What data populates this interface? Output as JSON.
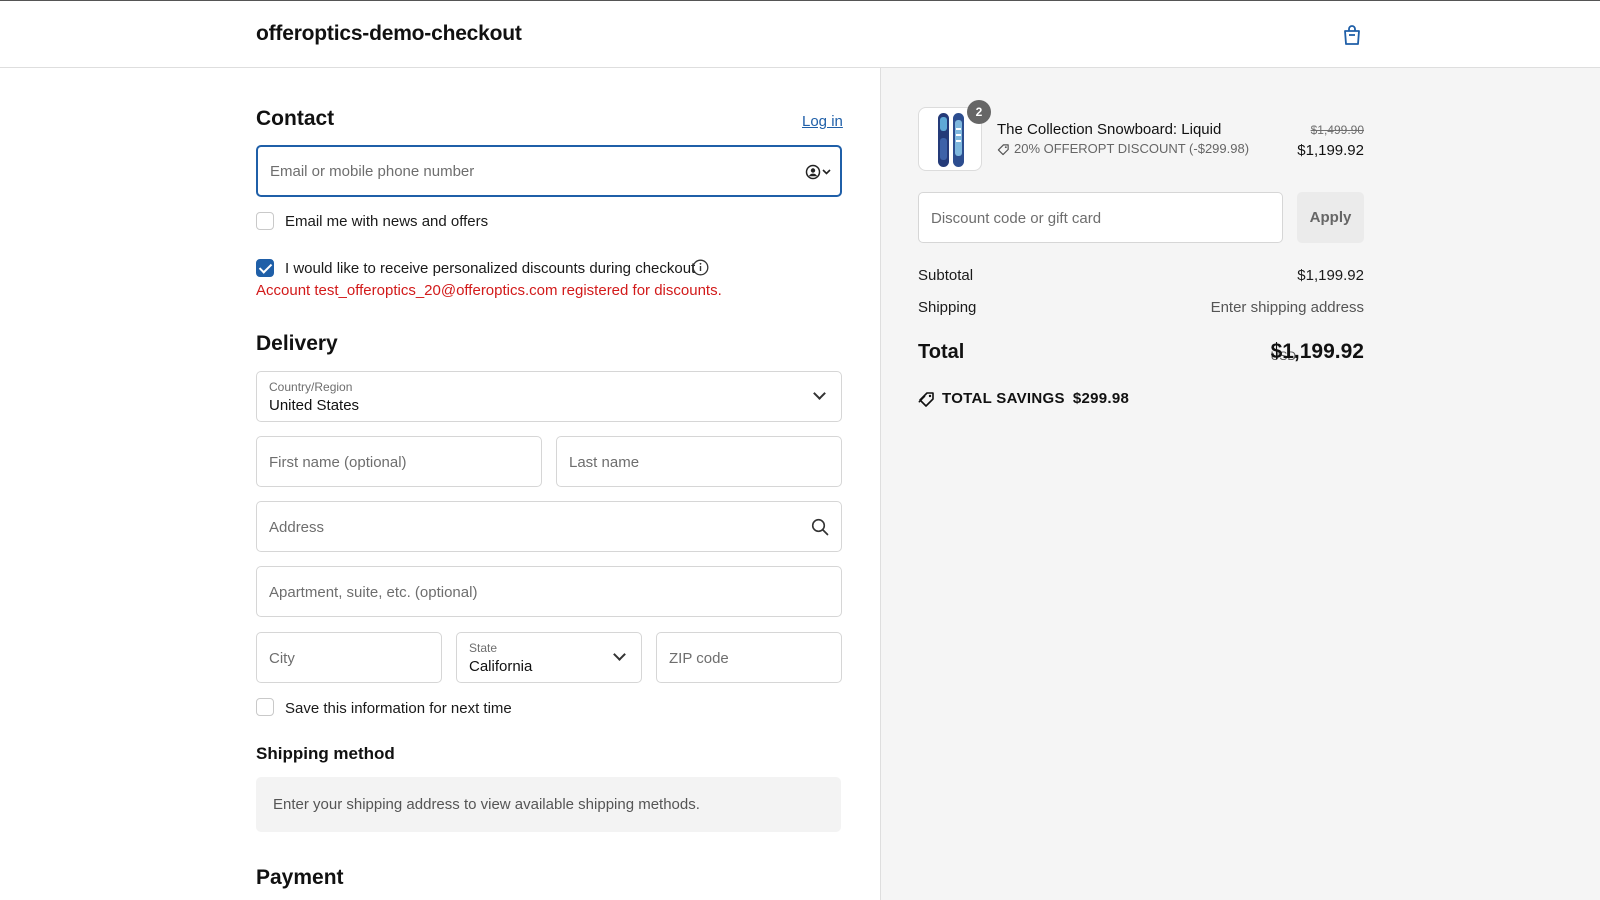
{
  "header": {
    "shop_name": "offeroptics-demo-checkout",
    "cart_icon": "shopping-bag-icon"
  },
  "contact": {
    "title": "Contact",
    "login_link": "Log in",
    "email_placeholder": "Email or mobile phone number",
    "email_value": "",
    "news_label": "Email me with news and offers",
    "news_checked": false,
    "personal_label": "I would like to receive personalized discounts during checkout",
    "personal_checked": true,
    "error_msg": "Account test_offeroptics_20@offeroptics.com registered for discounts."
  },
  "delivery": {
    "title": "Delivery",
    "country_label": "Country/Region",
    "country_value": "United States",
    "first_name_ph": "First name (optional)",
    "last_name_ph": "Last name",
    "address_ph": "Address",
    "apt_ph": "Apartment, suite, etc. (optional)",
    "city_ph": "City",
    "state_label": "State",
    "state_value": "California",
    "zip_ph": "ZIP code",
    "save_label": "Save this information for next time",
    "save_checked": false
  },
  "shipping": {
    "title": "Shipping method",
    "info": "Enter your shipping address to view available shipping methods."
  },
  "payment": {
    "title": "Payment"
  },
  "summary": {
    "product_name": "The Collection Snowboard: Liquid",
    "quantity": "2",
    "discount_label": "20% OFFEROPT DISCOUNT (-$299.98)",
    "original_price": "$1,499.90",
    "price": "$1,199.92",
    "discount_placeholder": "Discount code or gift card",
    "apply_label": "Apply",
    "subtotal_label": "Subtotal",
    "subtotal_value": "$1,199.92",
    "shipping_label": "Shipping",
    "shipping_value": "Enter shipping address",
    "total_label": "Total",
    "total_currency": "USD",
    "total_value": "$1,199.92",
    "savings_label": "TOTAL SAVINGS",
    "savings_value": "$299.98"
  },
  "colors": {
    "accent": "#1f5fa8",
    "error": "#d21a1a",
    "panel_bg": "#f5f5f5"
  }
}
